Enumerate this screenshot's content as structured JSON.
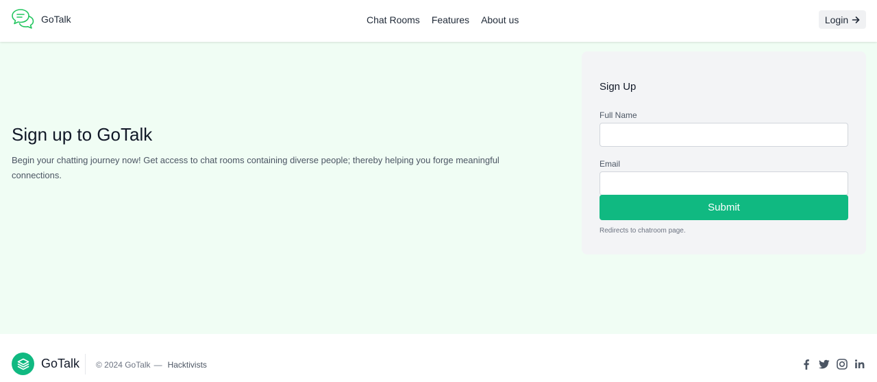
{
  "header": {
    "brand": "GoTalk",
    "nav": [
      {
        "label": "Chat Rooms"
      },
      {
        "label": "Features"
      },
      {
        "label": "About us"
      }
    ],
    "login_label": "Login",
    "logo_icon": "chat-bubbles-icon",
    "login_icon": "arrow-right-icon"
  },
  "hero": {
    "title": "Sign up to GoTalk",
    "description": "Begin your chatting journey now! Get access to chat rooms containing diverse people; thereby helping you forge meaningful connections."
  },
  "signup": {
    "title": "Sign Up",
    "full_name_label": "Full Name",
    "full_name_value": "",
    "email_label": "Email",
    "email_value": "",
    "submit_label": "Submit",
    "hint": "Redirects to chatroom page."
  },
  "footer": {
    "brand": "GoTalk",
    "copyright": "© 2024 GoTalk",
    "dash": "—",
    "team": "Hacktivists",
    "logo_icon": "layers-icon",
    "socials": [
      "facebook-icon",
      "twitter-icon",
      "instagram-icon",
      "linkedin-icon"
    ]
  },
  "colors": {
    "accent": "#10b981",
    "main_bg": "#f0fdf4",
    "card_bg": "#f3f4f6",
    "logo_green": "#22c55e"
  }
}
